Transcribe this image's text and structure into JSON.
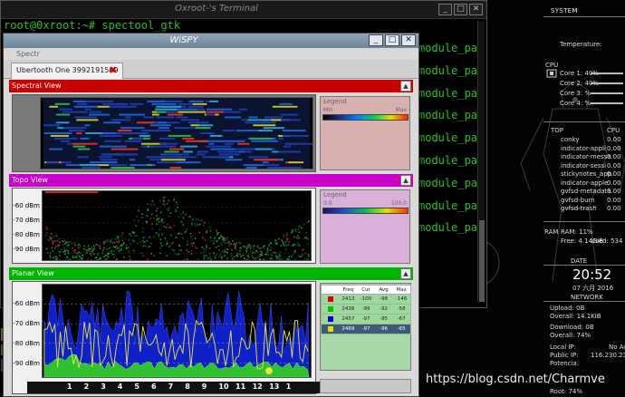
{
  "terminal": {
    "title": "Oxroot-'s Terminal",
    "prompt": "root@0xroot:~# spectool_gtk",
    "right_fragment": "module_pat",
    "right_lines": 9,
    "left_fragments": [
      "(",
      "h",
      "(",
      "h",
      "(",
      "h",
      "(",
      "h",
      "(",
      "h",
      "(",
      "h",
      "(",
      "h"
    ]
  },
  "wispy": {
    "title": "WiSPY",
    "menu_label": "Spectr",
    "tab_label": "Ubertooth One 3992191569",
    "views": {
      "spectral": {
        "label": "Spectral View",
        "color": "#c80000"
      },
      "topo": {
        "label": "Topo View",
        "color": "#c800c8"
      },
      "planar": {
        "label": "Planar View",
        "color": "#00b400"
      }
    },
    "legend": {
      "title": "Legend",
      "min": "Min",
      "max": "Max",
      "topo_min": "0.0",
      "topo_max": "100.0"
    },
    "dbm_labels_topo": [
      "-60 dBm",
      "-70 dBm",
      "-80 dBm",
      "-90 dBm"
    ],
    "dbm_labels_planar": [
      "-60 dBm",
      "-70 dBm",
      "-80 dBm",
      "-90 dBm"
    ],
    "channels": [
      "1",
      "2",
      "3",
      "4",
      "5",
      "6",
      "7",
      "8",
      "9",
      "10",
      "11",
      "12",
      "13",
      "1"
    ],
    "freq_table": {
      "headers": [
        "Freq",
        "Cur",
        "Avg",
        "Max"
      ],
      "rows": [
        {
          "color": "#e00000",
          "freq": "2413",
          "cur": "-100",
          "avg": "-98",
          "max": "-146"
        },
        {
          "color": "#00c000",
          "freq": "2438",
          "cur": "-99",
          "avg": "-92",
          "max": "-58"
        },
        {
          "color": "#0000e0",
          "freq": "2457",
          "cur": "-97",
          "avg": "-95",
          "max": "-67"
        },
        {
          "color": "#e0e000",
          "freq": "2469",
          "cur": "-97",
          "avg": "-96",
          "max": "-65"
        }
      ]
    }
  },
  "conky": {
    "system_label": "SYSTEM",
    "temperature_label": "Temperature:",
    "cpu_label": "CPU",
    "cores": [
      "Core 1: 40%",
      "Core 2: 40%",
      "Core 3: %",
      "Core 4: %"
    ],
    "top_label": "TOP",
    "top_cpu_label": "CPU",
    "processes": [
      {
        "name": "conky",
        "cpu": "0.00"
      },
      {
        "name": "indicator-appli",
        "cpu": "0.00"
      },
      {
        "name": "indicator-messa",
        "cpu": "0.00"
      },
      {
        "name": "indicator-sessi",
        "cpu": "0.00"
      },
      {
        "name": "stickynotes_app",
        "cpu": "0.00"
      },
      {
        "name": "indicator-apple",
        "cpu": "0.00"
      },
      {
        "name": "gvfsd-metadata",
        "cpu": "0.00"
      },
      {
        "name": "gvfsd-burn",
        "cpu": "0.00"
      },
      {
        "name": "gvfsd-trash",
        "cpu": "0.00"
      }
    ],
    "ram_label": "RAM",
    "ram_pct": "RAM: 11%",
    "ram_free": "Free: 4.14GiB",
    "ram_used": "Used: 534",
    "date_label": "DATE",
    "time": "20:52",
    "date": "07 六月 2016",
    "network_label": "NETWORK",
    "upload": "Upload: 0B",
    "upload_overall": "Overall: 14.1KiB",
    "download": "Download: 0B",
    "download_overall": "Overall: 74%",
    "local_ip": "Local IP:",
    "local_ip_val": "No Ac",
    "public_ip": "Public IP:",
    "public_ip_val": "116.230.23",
    "potencia": "Potencia:",
    "root_usage": "Root: 74%"
  },
  "watermark": "https://blog.csdn.net/Charmve",
  "colors": {
    "spectral_bg": "#0a1430",
    "spectral_legend_bg": "#d8b0b0",
    "topo_legend_bg": "#d8b0d8",
    "planar_legend_bg": "#a8d8a8",
    "planar_fill": "#1020c8"
  }
}
